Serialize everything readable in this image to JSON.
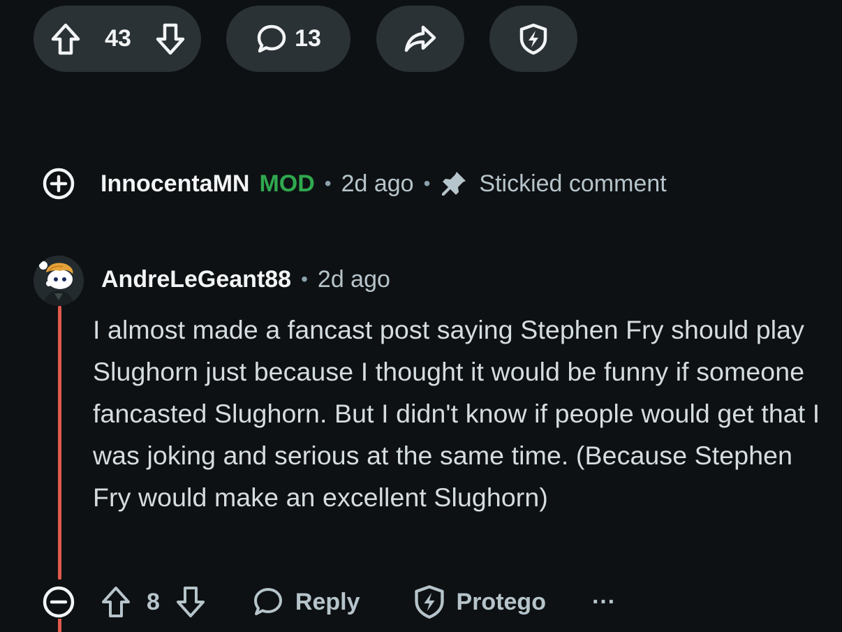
{
  "post_actions": {
    "score": "43",
    "comments_count": "13"
  },
  "sticky_comment": {
    "author": "InnocentaMN",
    "badge": "MOD",
    "separator": "•",
    "time": "2d ago",
    "status": "Stickied comment"
  },
  "comment": {
    "author": "AndreLeGeant88",
    "separator": "•",
    "time": "2d ago",
    "body": "I almost made a fancast post saying Stephen Fry should play Slughorn just because I thought it would be funny if someone fancasted Slughorn. But I didn't know if people would get that I was joking and serious at the same time. (Because Stephen Fry would make an excellent Slughorn)",
    "score": "8",
    "reply_label": "Reply",
    "award_label": "Protego",
    "more_label": "···"
  },
  "colors": {
    "background": "#0e1113",
    "pill": "#2a3236",
    "mod_green": "#2fa84f",
    "thread_line": "#e05a4e",
    "muted_text": "#b6c4cb"
  },
  "icons": {
    "upvote": "arrow-up-icon",
    "downvote": "arrow-down-icon",
    "comments": "speech-bubble-icon",
    "share": "share-arrow-icon",
    "award": "shield-bolt-icon",
    "expand": "plus-circle-icon",
    "collapse": "minus-circle-icon",
    "pin": "pin-icon",
    "more": "ellipsis-icon"
  }
}
